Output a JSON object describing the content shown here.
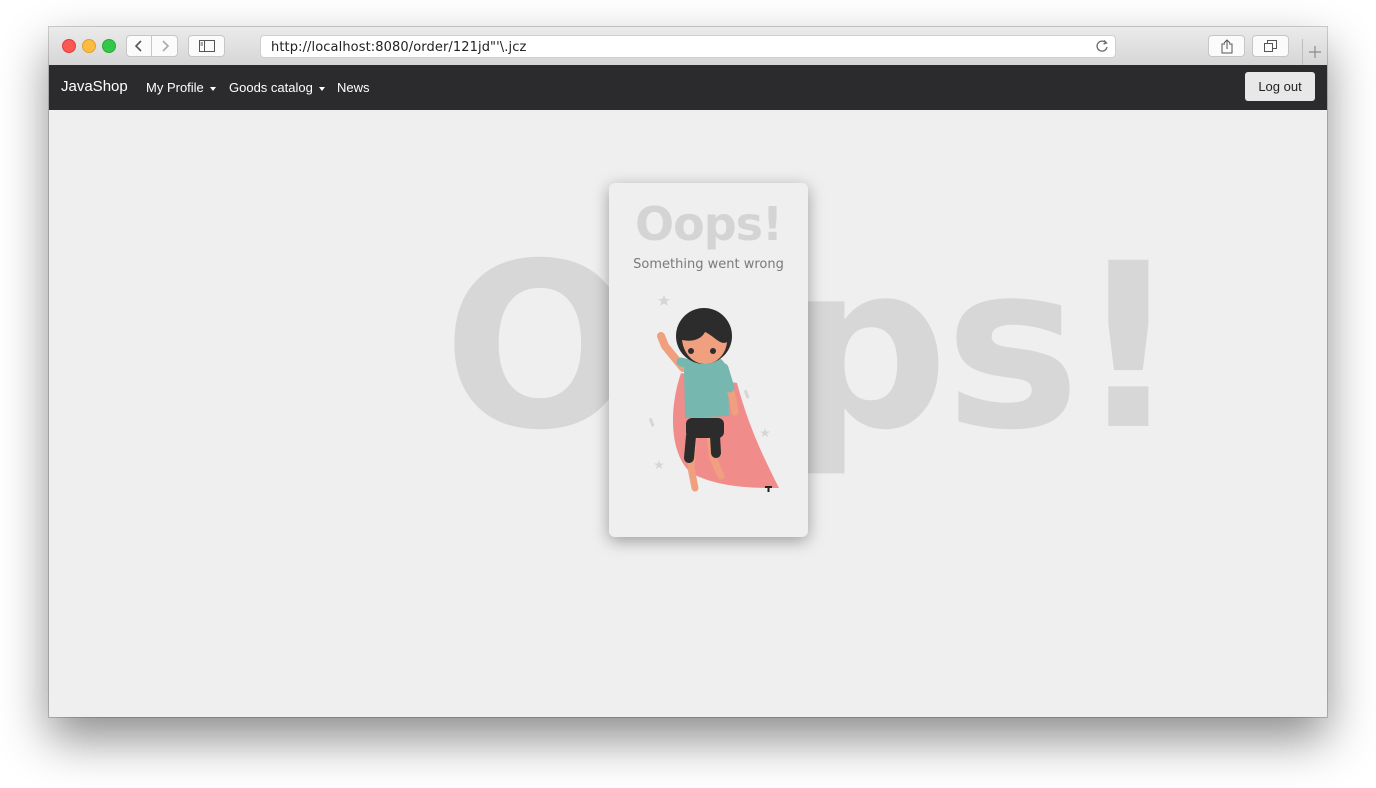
{
  "browser": {
    "url": "http://localhost:8080/order/121jd\"'\\.jcz"
  },
  "navbar": {
    "brand": "JavaShop",
    "items": [
      {
        "label": "My Profile",
        "dropdown": true
      },
      {
        "label": "Goods catalog",
        "dropdown": true
      },
      {
        "label": "News",
        "dropdown": false
      }
    ],
    "logout_label": "Log out"
  },
  "error": {
    "background_text": "Oops!",
    "title": "Oops!",
    "subtitle": "Something went wrong"
  },
  "colors": {
    "navbar_bg": "#2b2b2d",
    "page_bg": "#efefef",
    "cape": "#f08d8a",
    "shirt": "#76b8b0"
  },
  "icons": [
    "back-icon",
    "forward-icon",
    "sidebar-icon",
    "reload-icon",
    "share-icon",
    "tabs-icon",
    "new-tab-icon"
  ]
}
